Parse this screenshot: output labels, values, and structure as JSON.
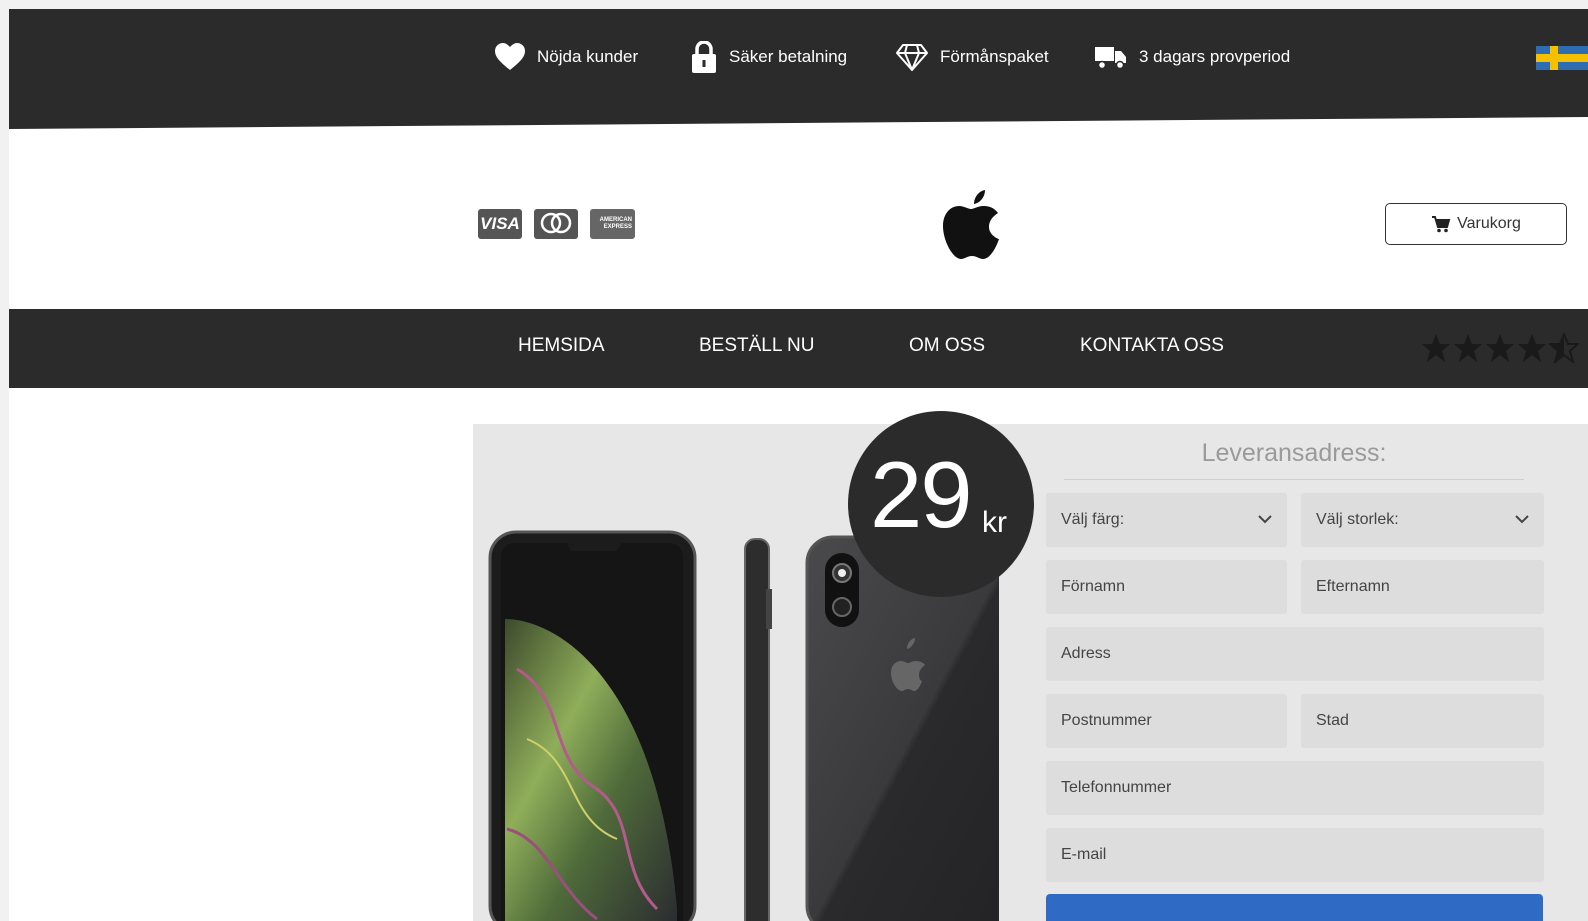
{
  "topbar": {
    "items": [
      {
        "label": "Nöjda kunder",
        "icon": "heart-icon"
      },
      {
        "label": "Säker betalning",
        "icon": "lock-icon"
      },
      {
        "label": "Förmånspaket",
        "icon": "diamond-icon"
      },
      {
        "label": "3 dagars provperiod",
        "icon": "truck-icon"
      }
    ],
    "language_flag": "sweden-flag-icon"
  },
  "header": {
    "payment_cards": [
      "VISA",
      "mastercard",
      "AMERICAN EXPRESS"
    ],
    "logo": "apple-logo-icon",
    "cart_label": "Varukorg"
  },
  "nav": {
    "items": [
      "HEMSIDA",
      "BESTÄLL NU",
      "OM OSS",
      "KONTAKTA OSS"
    ],
    "rating": 4.5
  },
  "product": {
    "price_value": "29",
    "price_currency": "kr"
  },
  "form": {
    "title": "Leveransadress:",
    "color_select": "Välj färg:",
    "size_select": "Välj storlek:",
    "first_name": "Förnamn",
    "last_name": "Efternamn",
    "address": "Adress",
    "postal_code": "Postnummer",
    "city": "Stad",
    "phone": "Telefonnummer",
    "email": "E-mail"
  },
  "colors": {
    "dark": "#2b2b2b",
    "accent_blue": "#2f6bc4",
    "field_bg": "#dddddd"
  }
}
